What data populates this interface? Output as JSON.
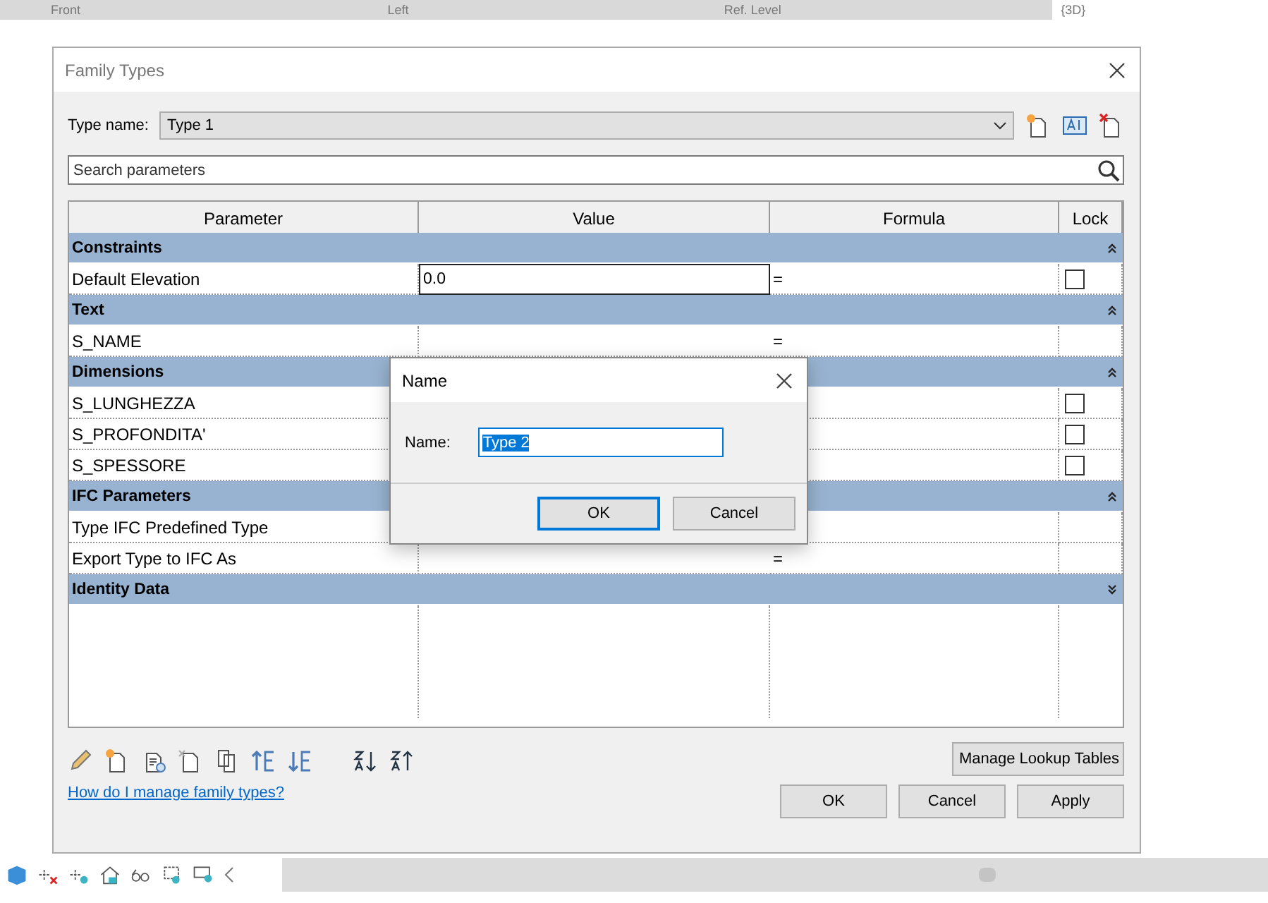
{
  "view_tabs": [
    {
      "label": "Front",
      "selected": false
    },
    {
      "label": "Left",
      "selected": false
    },
    {
      "label": "Ref. Level",
      "selected": false
    },
    {
      "label": "{3D}",
      "selected": true
    }
  ],
  "dialog": {
    "title": "Family Types",
    "type_name": {
      "label": "Type name:",
      "value": "Type 1"
    },
    "search": {
      "placeholder": "Search parameters"
    },
    "columns": [
      "Parameter",
      "Value",
      "Formula",
      "Lock"
    ],
    "groups": [
      {
        "name": "Constraints",
        "expanded": true,
        "rows": [
          {
            "parameter": "Default Elevation",
            "value": "0.0",
            "editing": true,
            "formula": "=",
            "locked": false
          }
        ]
      },
      {
        "name": "Text",
        "expanded": true,
        "rows": [
          {
            "parameter": "S_NAME",
            "formula": "="
          }
        ]
      },
      {
        "name": "Dimensions",
        "expanded": true,
        "rows": [
          {
            "parameter": "S_LUNGHEZZA",
            "locked": false
          },
          {
            "parameter": "S_PROFONDITA'",
            "locked": false
          },
          {
            "parameter": "S_SPESSORE",
            "locked": false
          }
        ]
      },
      {
        "name": "IFC Parameters",
        "expanded": true,
        "rows": [
          {
            "parameter": "Type IFC Predefined Type"
          },
          {
            "parameter": "Export Type to IFC As",
            "formula": "="
          }
        ]
      },
      {
        "name": "Identity Data",
        "expanded": false
      }
    ],
    "lookup_button": "Manage Lookup Tables",
    "help_link": "How do I manage family types?",
    "buttons": [
      "OK",
      "Cancel",
      "Apply"
    ]
  },
  "name_dialog": {
    "title": "Name",
    "label": "Name:",
    "value": "Type 2",
    "value_selected": true,
    "buttons": [
      {
        "label": "OK",
        "default": true
      },
      {
        "label": "Cancel",
        "default": false
      }
    ]
  }
}
